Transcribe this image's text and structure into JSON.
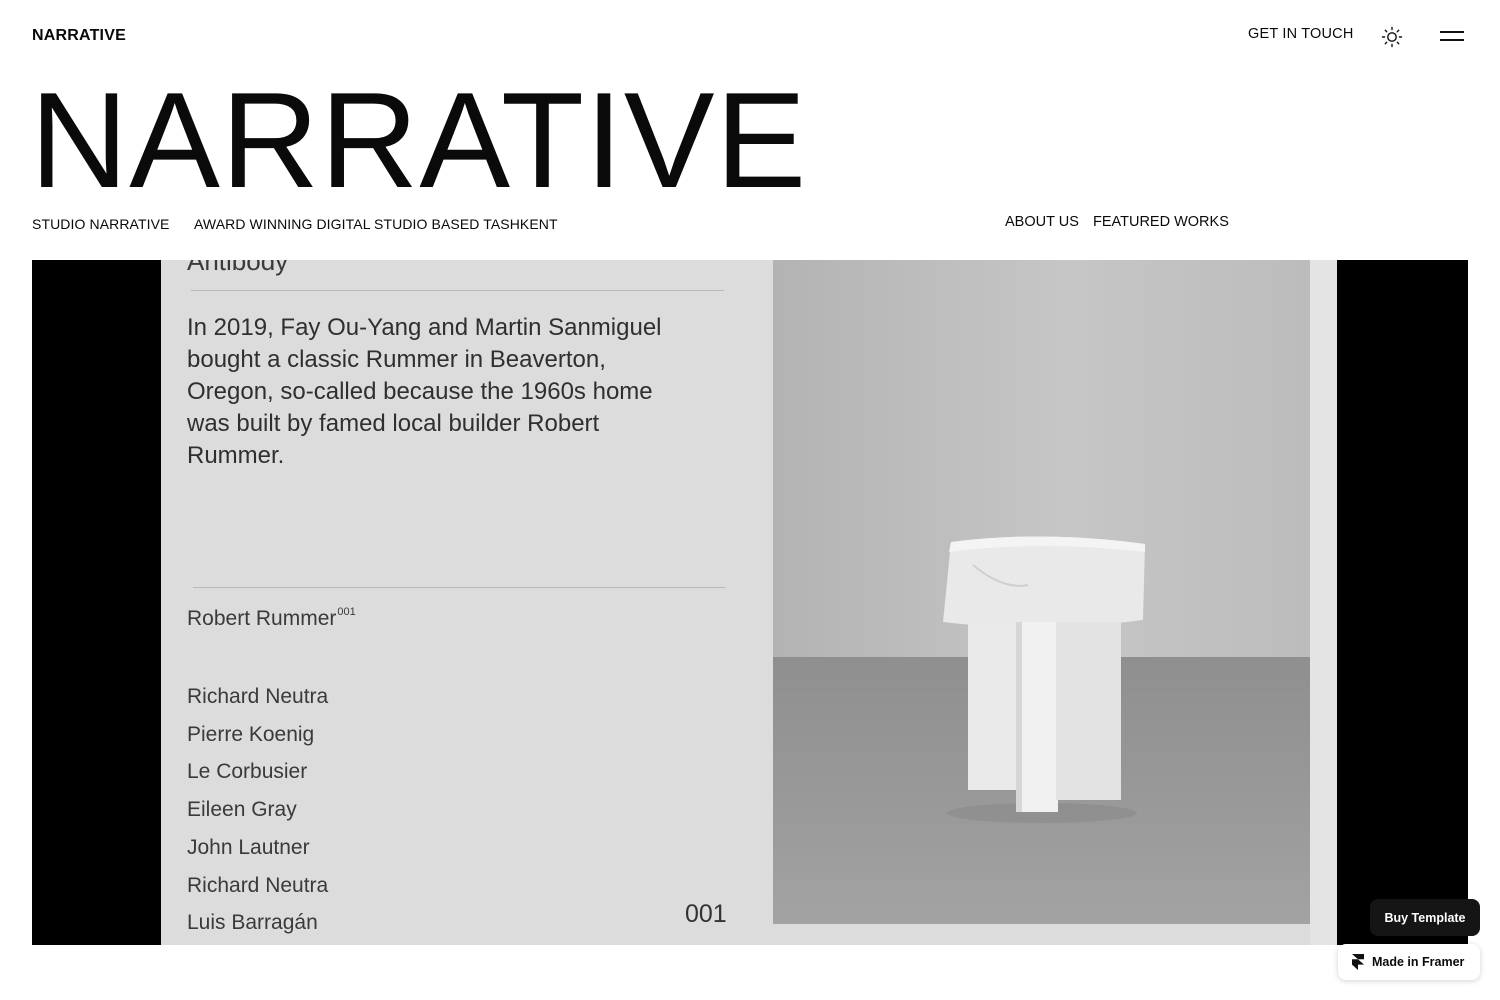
{
  "header": {
    "logo": "NARRATIVE",
    "cta": "GET IN TOUCH",
    "theme_icon": "sun-icon",
    "menu_icon": "hamburger-menu-icon"
  },
  "hero": {
    "title": "NARRATIVE",
    "studio": "STUDIO NARRATIVE",
    "tagline": "AWARD WINNING DIGITAL STUDIO BASED TASHKENT"
  },
  "nav": {
    "about": "ABOUT US",
    "works": "FEATURED WORKS"
  },
  "media": {
    "cut_title": "Antibody",
    "paragraph": "In 2019, Fay Ou-Yang and Martin Sanmiguel bought a classic Rummer in Beaverton, Oregon, so-called because the 1960s home was built by famed local builder Robert Rummer.",
    "author": "Robert Rummer",
    "author_sup": "001",
    "names": [
      "Richard Neutra",
      "Pierre Koenig",
      "Le Corbusier",
      "Eileen Gray",
      "John Lautner",
      "Richard Neutra",
      "Luis Barragán"
    ],
    "page_number": "001",
    "photo_subject": "marble-stool-photo"
  },
  "badges": {
    "buy": "Buy Template",
    "framer": "Made in Framer",
    "framer_icon": "framer-logo-icon"
  },
  "colors": {
    "background": "#ffffff",
    "text": "#0a0a0a",
    "media_bg": "#000000",
    "paper": "#dcdcdc",
    "badge_dark": "#151515"
  }
}
